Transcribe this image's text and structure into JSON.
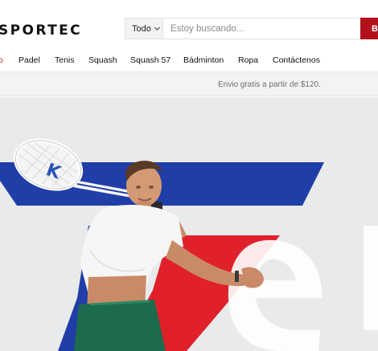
{
  "header": {
    "logo": "SPORTEC",
    "search": {
      "category": "Todo",
      "placeholder": "Estoy buscando...",
      "button_label": "Buscar"
    }
  },
  "nav": {
    "items": [
      {
        "label": "o",
        "active": true
      },
      {
        "label": "Padel"
      },
      {
        "label": "Tenis"
      },
      {
        "label": "Squash"
      },
      {
        "label": "Squash 57"
      },
      {
        "label": "Bádminton"
      },
      {
        "label": "Ropa"
      },
      {
        "label": "Contáctenos"
      }
    ]
  },
  "shipping": {
    "text": "Envio gratis a partir de $120."
  },
  "colors": {
    "accent_red": "#b3121c",
    "hero_blue": "#1f3ea8",
    "hero_red": "#e0202a",
    "hero_bg": "#e9eaeb"
  }
}
